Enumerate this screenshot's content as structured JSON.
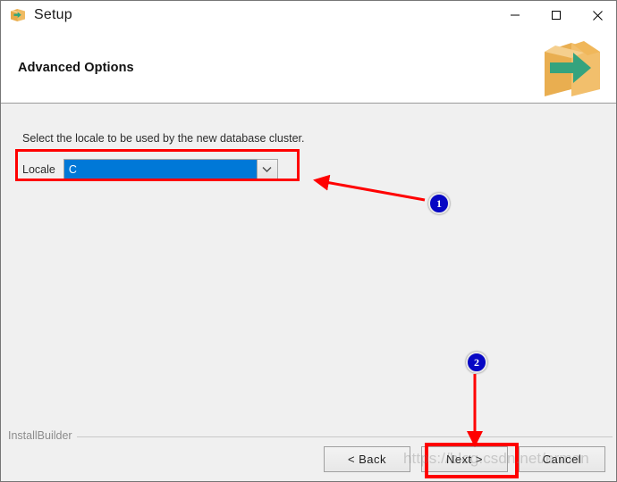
{
  "window": {
    "title": "Setup",
    "icon": "installer-box-icon",
    "controls": {
      "minimize": "minimize-icon",
      "maximize": "maximize-icon",
      "close": "close-icon"
    }
  },
  "header": {
    "title": "Advanced Options",
    "logo": "installbuilder-box-arrow-logo"
  },
  "main": {
    "prompt": "Select the locale to be used by the new database cluster.",
    "locale": {
      "label": "Locale",
      "value": "C",
      "placeholder": "C",
      "dropdown_icon": "chevron-down-icon"
    }
  },
  "footer": {
    "brand": "InstallBuilder",
    "buttons": {
      "back": "< Back",
      "next": "Next >",
      "cancel": "Cancel"
    }
  },
  "annotations": {
    "badge_one": "1",
    "badge_two": "2",
    "arrow_one": "red-arrow-pointing-to-locale-combobox",
    "arrow_two": "red-arrow-pointing-to-next-button",
    "highlight_one": "red-rectangle-around-locale-row",
    "highlight_two": "red-rectangle-around-next-button"
  },
  "watermark": {
    "text": "https://blog.csdn.net/erman"
  },
  "colors": {
    "selection_blue": "#0078d7",
    "annotation_red": "#ff0000",
    "badge_blue": "#0707c4",
    "body_gray": "#f0f0f0",
    "logo_orange": "#f0b75a",
    "logo_green": "#35a37e"
  }
}
